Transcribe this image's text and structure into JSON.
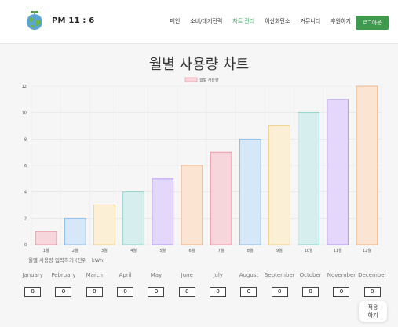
{
  "header": {
    "brand": "PM 11 : 6",
    "nav": [
      "메인",
      "소비/대기전력",
      "차트 관리",
      "이산화탄소",
      "커뮤니티",
      "후원하기"
    ],
    "active_index": 2,
    "logout_label": "로그아웃",
    "logo_icon": "earth-plant-icon"
  },
  "page": {
    "title": "월별 사용량 차트",
    "input_label": "월별 사용량 입력하기 (단위 : kWh)",
    "apply_label": "적용\n하기"
  },
  "months": [
    {
      "name": "January",
      "value": "0"
    },
    {
      "name": "February",
      "value": "0"
    },
    {
      "name": "March",
      "value": "0"
    },
    {
      "name": "April",
      "value": "0"
    },
    {
      "name": "May",
      "value": "0"
    },
    {
      "name": "June",
      "value": "0"
    },
    {
      "name": "July",
      "value": "0"
    },
    {
      "name": "August",
      "value": "0"
    },
    {
      "name": "September",
      "value": "0"
    },
    {
      "name": "October",
      "value": "0"
    },
    {
      "name": "November",
      "value": "0"
    },
    {
      "name": "December",
      "value": "0"
    }
  ],
  "chart_data": {
    "type": "bar",
    "categories": [
      "1월",
      "2월",
      "3월",
      "4월",
      "5월",
      "6월",
      "7월",
      "8월",
      "9월",
      "10월",
      "11월",
      "12월"
    ],
    "series": [
      {
        "name": "월별 사용량",
        "values": [
          1,
          2,
          3,
          4,
          5,
          6,
          7,
          8,
          9,
          10,
          11,
          12
        ]
      }
    ],
    "ylim": [
      0,
      12
    ],
    "yticks": [
      0,
      2,
      4,
      6,
      8,
      10,
      12
    ],
    "legend": "top-center",
    "grid": true,
    "legend_color": "#f7d6db",
    "colors": [
      {
        "fill": "#f7d6db",
        "stroke": "#e78a9a"
      },
      {
        "fill": "#d6e8f8",
        "stroke": "#7ab3e5"
      },
      {
        "fill": "#fbf0d6",
        "stroke": "#efcb7e"
      },
      {
        "fill": "#d6efee",
        "stroke": "#80c9c4"
      },
      {
        "fill": "#e3d8fb",
        "stroke": "#a788ef"
      },
      {
        "fill": "#fbe4d2",
        "stroke": "#f0aa74"
      }
    ]
  }
}
